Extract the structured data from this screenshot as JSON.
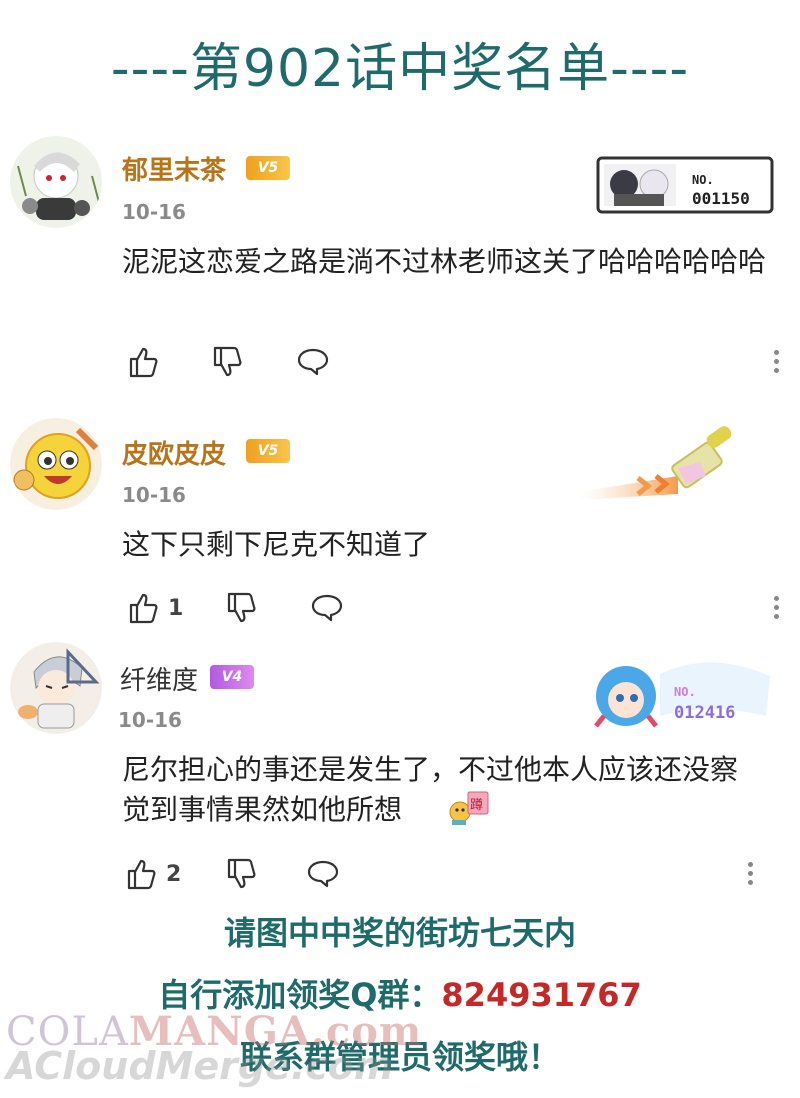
{
  "header": {
    "title": "----第902话中奖名单----"
  },
  "comments": [
    {
      "username": "郁里末茶",
      "level": "V5",
      "date": "10-16",
      "text": "泥泥这恋爱之路是淌不过林老师这关了哈哈哈哈哈哈",
      "likes": "",
      "badge_number": "NO.\n001150"
    },
    {
      "username": "皮欧皮皮",
      "level": "V5",
      "date": "10-16",
      "text": "这下只剩下尼克不知道了",
      "likes": "1"
    },
    {
      "username": "纤维度",
      "level": "V4",
      "date": "10-16",
      "text": "尼尔担心的事还是发生了，不过他本人应该还没察觉到事情果然如他所想",
      "likes": "2",
      "badge_number": "NO.\n012416"
    }
  ],
  "footer": {
    "line1": "请图中中奖的街坊七天内",
    "line2_prefix": "自行添加领奖Q群：",
    "qq_number": "824931767",
    "line3": "联系群管理员领奖哦！"
  },
  "watermark": {
    "line1_a": "COLA",
    "line1_b": "MANGA",
    "line1_c": ".com",
    "line2": "ACloudMerge.com"
  },
  "colors": {
    "title": "#1f6b6b",
    "gold_name": "#b8741a",
    "purple_name": "#333333",
    "v5_badge": "#f0a020",
    "v4_badge": "#c06ae0",
    "qq_number": "#c62828"
  }
}
